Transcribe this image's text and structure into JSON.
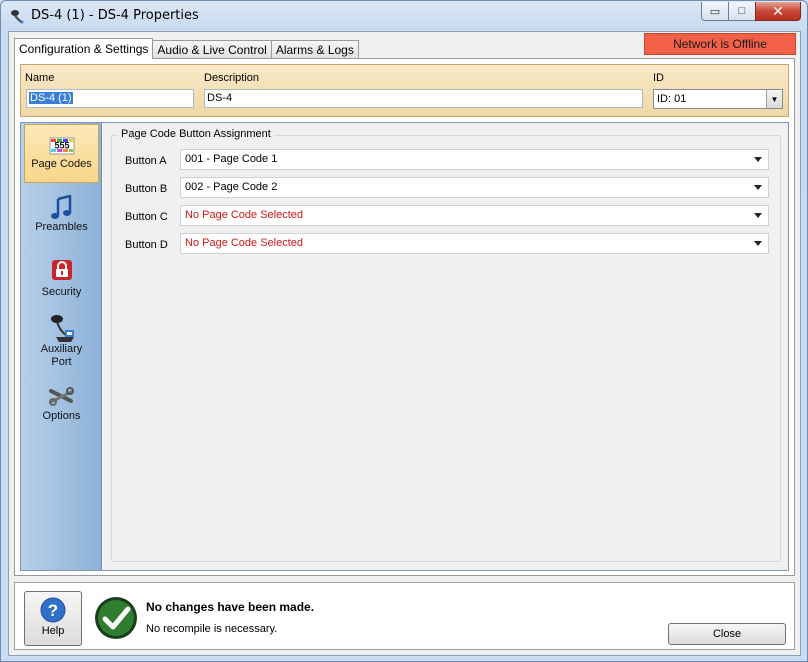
{
  "window": {
    "title": "DS-4 (1) - DS-4 Properties",
    "minimize_glyph": "▭",
    "maximize_glyph": "□",
    "close_glyph": "✕"
  },
  "tabs": [
    {
      "label": "Configuration & Settings",
      "active": true
    },
    {
      "label": "Audio & Live Control",
      "active": false
    },
    {
      "label": "Alarms & Logs",
      "active": false
    }
  ],
  "status": {
    "network": "Network is Offline",
    "color": "#f26048"
  },
  "header": {
    "name_label": "Name",
    "name_value": "DS-4 (1)",
    "description_label": "Description",
    "description_value": "DS-4",
    "id_label": "ID",
    "id_value": "ID: 01"
  },
  "sidebar": {
    "items": [
      {
        "label": "Page Codes",
        "icon": "page-codes-icon",
        "icon_text": "555",
        "active": true
      },
      {
        "label": "Preambles",
        "icon": "music-note-icon",
        "active": false
      },
      {
        "label": "Security",
        "icon": "lock-icon",
        "active": false
      },
      {
        "label": "Auxiliary Port",
        "icon": "microphone-icon",
        "active": false
      },
      {
        "label": "Options",
        "icon": "tools-icon",
        "active": false
      }
    ]
  },
  "assignment": {
    "group_title": "Page Code Button Assignment",
    "rows": [
      {
        "label": "Button A",
        "value": "001 - Page Code 1",
        "empty": false
      },
      {
        "label": "Button B",
        "value": "002 - Page Code 2",
        "empty": false
      },
      {
        "label": "Button C",
        "value": "No Page Code Selected",
        "empty": true
      },
      {
        "label": "Button D",
        "value": "No Page Code Selected",
        "empty": true
      }
    ]
  },
  "footer": {
    "help_label": "Help",
    "message_title": "No changes have been made.",
    "message_detail": "No recompile is necessary.",
    "close_label": "Close"
  }
}
